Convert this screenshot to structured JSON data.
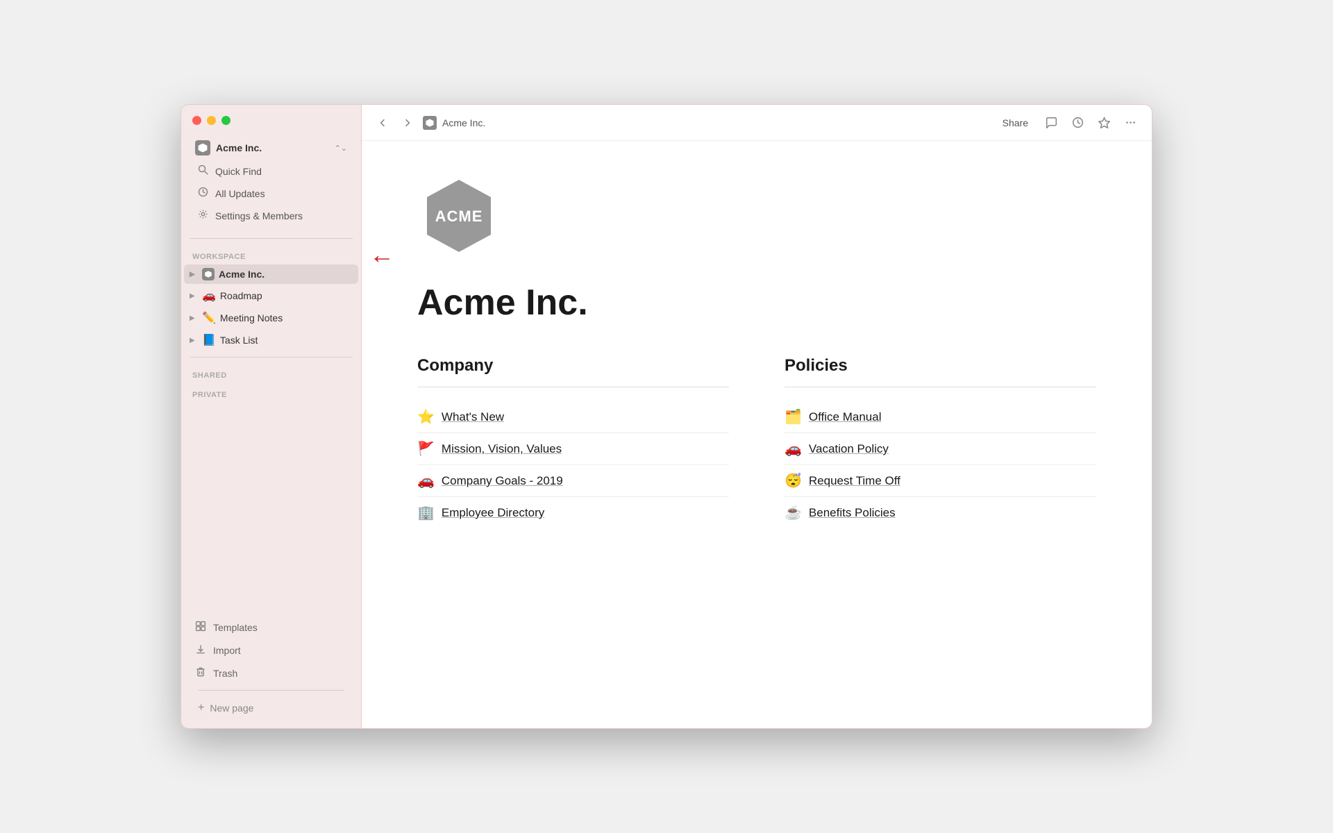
{
  "window": {
    "title": "Acme Inc."
  },
  "sidebar": {
    "workspace_name": "Acme Inc.",
    "nav_items": [
      {
        "id": "quick-find",
        "icon": "🔍",
        "label": "Quick Find"
      },
      {
        "id": "all-updates",
        "icon": "🕐",
        "label": "All Updates"
      },
      {
        "id": "settings",
        "icon": "⚙️",
        "label": "Settings & Members"
      }
    ],
    "workspace_section_label": "WORKSPACE",
    "workspace_items": [
      {
        "id": "acme-inc",
        "emoji": "",
        "label": "Acme Inc.",
        "active": true,
        "icon_type": "logo"
      },
      {
        "id": "roadmap",
        "emoji": "🚗",
        "label": "Roadmap"
      },
      {
        "id": "meeting-notes",
        "emoji": "✏️",
        "label": "Meeting Notes"
      },
      {
        "id": "task-list",
        "emoji": "📘",
        "label": "Task List"
      }
    ],
    "shared_label": "SHARED",
    "private_label": "PRIVATE",
    "bottom_items": [
      {
        "id": "templates",
        "icon": "🎨",
        "label": "Templates"
      },
      {
        "id": "import",
        "icon": "⬇️",
        "label": "Import"
      },
      {
        "id": "trash",
        "icon": "🗑️",
        "label": "Trash"
      }
    ],
    "new_page_label": "New page"
  },
  "titlebar": {
    "breadcrumb_icon": "ACME",
    "breadcrumb_text": "Acme Inc.",
    "share_label": "Share",
    "buttons": [
      "comment",
      "history",
      "star",
      "more"
    ]
  },
  "page": {
    "title": "Acme Inc.",
    "sections": [
      {
        "id": "company",
        "title": "Company",
        "links": [
          {
            "emoji": "⭐",
            "text": "What's New"
          },
          {
            "emoji": "🚩",
            "text": "Mission, Vision, Values"
          },
          {
            "emoji": "🚗",
            "text": "Company Goals - 2019"
          },
          {
            "emoji": "🏢",
            "text": "Employee Directory"
          }
        ]
      },
      {
        "id": "policies",
        "title": "Policies",
        "links": [
          {
            "emoji": "🗂️",
            "text": "Office Manual"
          },
          {
            "emoji": "🚗",
            "text": "Vacation Policy"
          },
          {
            "emoji": "😴",
            "text": "Request Time Off"
          },
          {
            "emoji": "☕",
            "text": "Benefits Policies"
          }
        ]
      }
    ]
  }
}
